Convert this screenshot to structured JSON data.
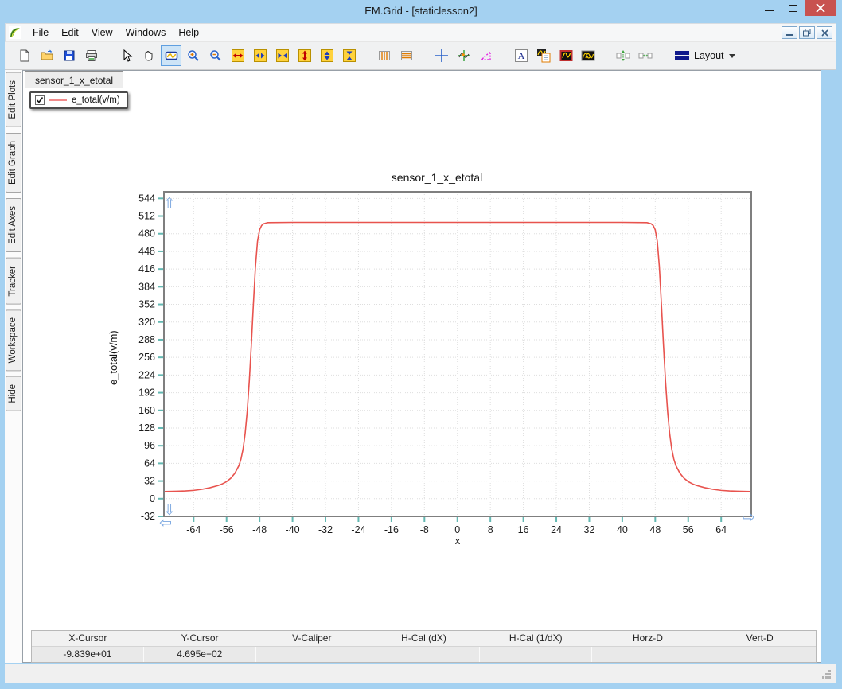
{
  "window": {
    "title": "EM.Grid - [staticlesson2]"
  },
  "menu": {
    "items": [
      "File",
      "Edit",
      "View",
      "Windows",
      "Help"
    ]
  },
  "toolbar": {
    "layout_label": "Layout",
    "text_tool_glyph": "A",
    "tools": [
      "new-document",
      "open-file",
      "save-file",
      "print",
      "select-arrow",
      "pan-hand",
      "zoom-region",
      "zoom-in",
      "zoom-out",
      "h-stretch",
      "h-expand",
      "h-compress",
      "v-stretch",
      "v-expand",
      "v-compress",
      "v-caliper",
      "h-caliper",
      "cross-tracker",
      "curve-tracker",
      "slope-caliper",
      "text-annotation",
      "plot-report",
      "edit-curve",
      "edit-curves",
      "v-spacing",
      "h-spacing",
      "layout-menu"
    ],
    "active_tool": "zoom-region"
  },
  "sidebar": {
    "tabs": [
      "Edit Plots",
      "Edit Graph",
      "Edit Axes",
      "Tracker",
      "Workspace",
      "Hide"
    ]
  },
  "tab": {
    "label": "sensor_1_x_etotal"
  },
  "legend": {
    "checked": true,
    "label": "e_total(v/m)"
  },
  "colors": {
    "curve": "#e8534e",
    "legend_line": "#f28b8b",
    "tick": "#63b8b2",
    "grid": "#dedede",
    "axis_border": "#7f7f7f",
    "pan_arrow": "#7aa7e0",
    "close_button": "#c85250",
    "titlebar_bg": "#a4d1f1"
  },
  "chart_data": {
    "type": "line",
    "title": "sensor_1_x_etotal",
    "xlabel": "x",
    "ylabel": "e_total(v/m)",
    "xlim": [
      -71.2,
      71.3
    ],
    "ylim": [
      -32,
      556
    ],
    "xticks": [
      -64,
      -56,
      -48,
      -40,
      -32,
      -24,
      -16,
      -8,
      0,
      8,
      16,
      24,
      32,
      40,
      48,
      56,
      64
    ],
    "yticks": [
      -32,
      0,
      32,
      64,
      96,
      128,
      160,
      192,
      224,
      256,
      288,
      320,
      352,
      384,
      416,
      448,
      480,
      512,
      544
    ],
    "grid": true,
    "legend_position": "top-left",
    "series": [
      {
        "name": "e_total(v/m)",
        "points": [
          [
            -71,
            13
          ],
          [
            -68,
            13.5
          ],
          [
            -66,
            14
          ],
          [
            -64,
            15
          ],
          [
            -62,
            17
          ],
          [
            -60,
            20
          ],
          [
            -58,
            24
          ],
          [
            -57,
            27
          ],
          [
            -56,
            31
          ],
          [
            -55,
            37
          ],
          [
            -54,
            46
          ],
          [
            -53,
            60
          ],
          [
            -52.5,
            72
          ],
          [
            -52,
            90
          ],
          [
            -51.5,
            118
          ],
          [
            -51,
            158
          ],
          [
            -50.5,
            212
          ],
          [
            -50,
            278
          ],
          [
            -49.5,
            352
          ],
          [
            -49,
            420
          ],
          [
            -48.5,
            466
          ],
          [
            -48,
            487
          ],
          [
            -47.5,
            495
          ],
          [
            -47,
            498
          ],
          [
            -46,
            500
          ],
          [
            -40,
            500.5
          ],
          [
            -30,
            500.5
          ],
          [
            -20,
            500.5
          ],
          [
            -10,
            500.5
          ],
          [
            0,
            500.5
          ],
          [
            10,
            500.5
          ],
          [
            20,
            500.5
          ],
          [
            30,
            500.5
          ],
          [
            40,
            500.5
          ],
          [
            46,
            500
          ],
          [
            47,
            498
          ],
          [
            47.5,
            495
          ],
          [
            48,
            487
          ],
          [
            48.5,
            466
          ],
          [
            49,
            420
          ],
          [
            49.5,
            352
          ],
          [
            50,
            278
          ],
          [
            50.5,
            212
          ],
          [
            51,
            158
          ],
          [
            51.5,
            118
          ],
          [
            52,
            90
          ],
          [
            52.5,
            72
          ],
          [
            53,
            60
          ],
          [
            54,
            46
          ],
          [
            55,
            37
          ],
          [
            56,
            31
          ],
          [
            57,
            27
          ],
          [
            58,
            24
          ],
          [
            60,
            20
          ],
          [
            62,
            17
          ],
          [
            64,
            15
          ],
          [
            66,
            14
          ],
          [
            68,
            13.5
          ],
          [
            71,
            13
          ]
        ]
      }
    ]
  },
  "status_table": {
    "columns": [
      "X-Cursor",
      "Y-Cursor",
      "V-Caliper",
      "H-Cal (dX)",
      "H-Cal (1/dX)",
      "Horz-D",
      "Vert-D"
    ],
    "values": [
      "-9.839e+01",
      "4.695e+02",
      "",
      "",
      "",
      "",
      ""
    ]
  }
}
